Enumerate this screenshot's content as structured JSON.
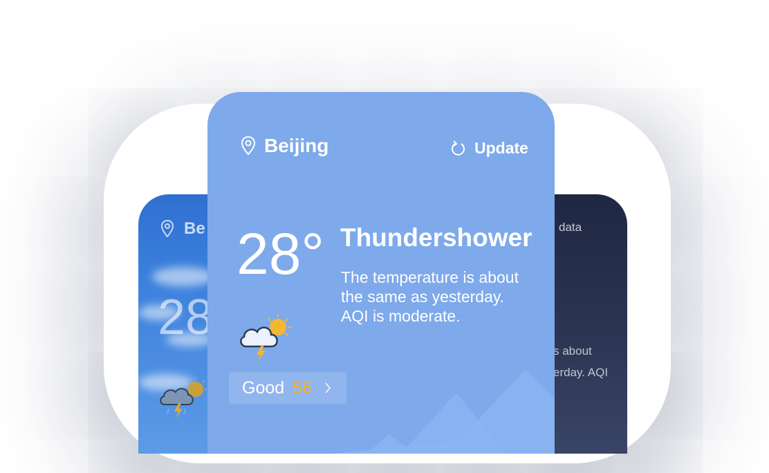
{
  "main_card": {
    "city": "Beijing",
    "update_label": "Update",
    "temperature": "28°",
    "condition": "Thundershower",
    "description_lines": [
      "The temperature is about",
      "the same as yesterday.",
      "AQI is moderate."
    ],
    "aqi_label": "Good",
    "aqi_value": "56",
    "icons": {
      "location": "location-pin-icon",
      "refresh": "refresh-icon",
      "weather": "thunderstorm-sun-icon",
      "chevron": "chevron-right-icon"
    }
  },
  "left_card": {
    "city_partial": "Be",
    "temperature_partial": "28"
  },
  "right_card": {
    "header_partial": "data",
    "description_lines_partial": [
      "s about",
      "erday. AQI"
    ]
  },
  "colors": {
    "main_card_bg": "#7ea9ea",
    "aqi_value": "#f0b13c",
    "night_card_bg": "#2a3350",
    "sky_card_bg": "#3b7fdc"
  }
}
